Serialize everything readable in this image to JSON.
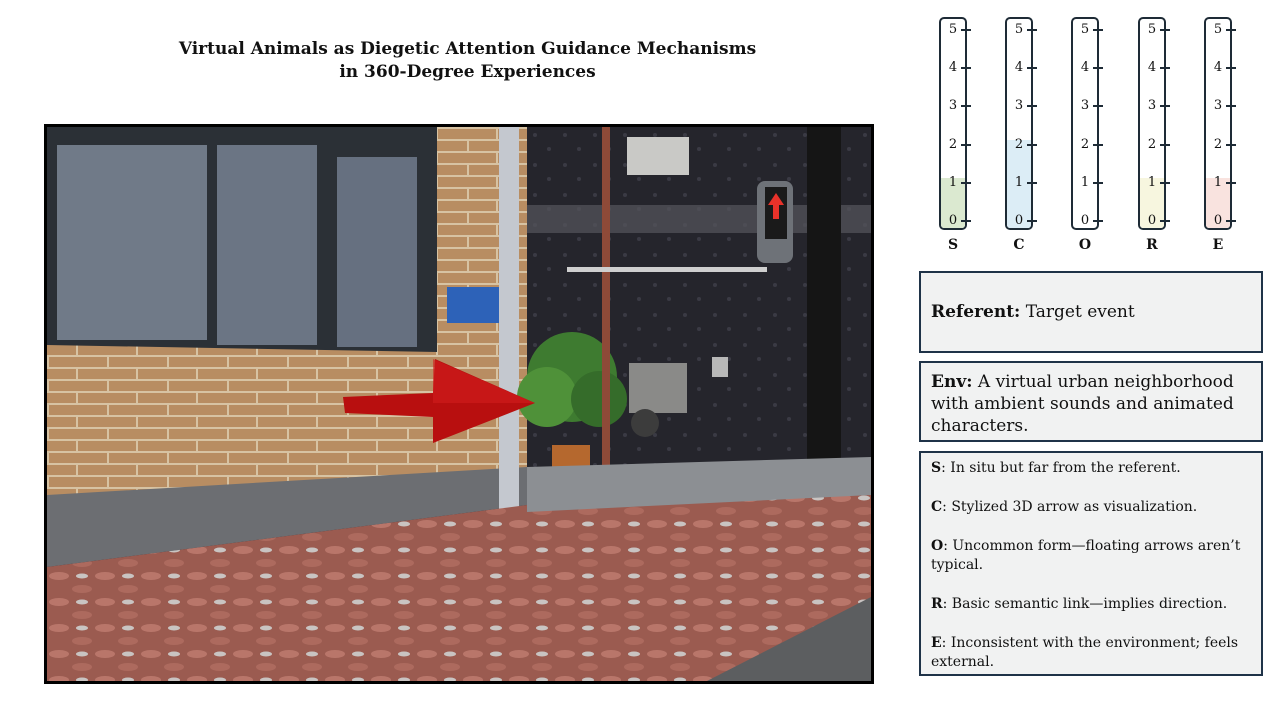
{
  "header": {
    "title_line1": "Virtual Animals as Diegetic Attention Guidance Mechanisms",
    "title_line2": "in 360-Degree Experiences"
  },
  "scene": {
    "description_sign_text": "",
    "arrow_color": "#b80f0f"
  },
  "scales": [
    {
      "letter": "S",
      "score": 1,
      "fill": "#dbe9d0",
      "ticks": [
        "5",
        "4",
        "3",
        "2",
        "1",
        "0"
      ]
    },
    {
      "letter": "C",
      "score": 2,
      "fill": "#dcedf6",
      "ticks": [
        "5",
        "4",
        "3",
        "2",
        "1",
        "0"
      ]
    },
    {
      "letter": "O",
      "score": 0,
      "fill": "#ffffff",
      "ticks": [
        "5",
        "4",
        "3",
        "2",
        "1",
        "0"
      ]
    },
    {
      "letter": "R",
      "score": 1,
      "fill": "#f7f6df",
      "ticks": [
        "5",
        "4",
        "3",
        "2",
        "1",
        "0"
      ]
    },
    {
      "letter": "E",
      "score": 1,
      "fill": "#f9e3df",
      "ticks": [
        "5",
        "4",
        "3",
        "2",
        "1",
        "0"
      ]
    }
  ],
  "referent": {
    "label": "Referent:",
    "text": "Target event"
  },
  "env": {
    "label": "Env:",
    "text": "A virtual urban neighborhood with ambient sounds and animated characters."
  },
  "criteria": [
    {
      "key": "S",
      "text": ": In situ but far from the referent."
    },
    {
      "key": "C",
      "text": ": Stylized 3D arrow as visualization."
    },
    {
      "key": "O",
      "text": ": Uncommon form—floating arrows aren’t typical."
    },
    {
      "key": "R",
      "text": ": Basic semantic link—implies direction."
    },
    {
      "key": "E",
      "text": ": Inconsistent with the environment; feels external."
    }
  ]
}
